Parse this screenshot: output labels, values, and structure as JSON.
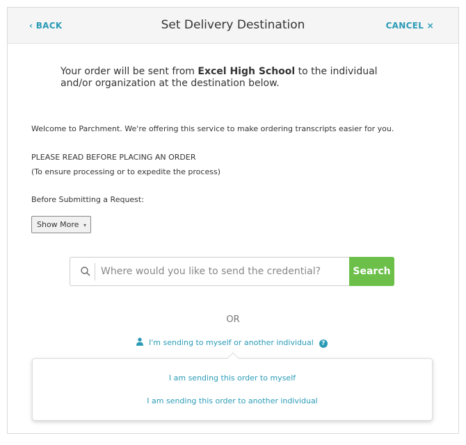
{
  "header": {
    "back_label": "‹ BACK",
    "title": "Set Delivery Destination",
    "cancel_label": "CANCEL ×"
  },
  "intro": {
    "prefix": "Your order will be sent from ",
    "school": "Excel High School",
    "suffix": " to the individual and/or organization at the destination below."
  },
  "notice": {
    "welcome": "Welcome to Parchment. We're offering this service to make ordering transcripts easier for you.",
    "read_heading": "PLEASE READ BEFORE PLACING AN ORDER",
    "read_sub": "(To ensure processing or to expedite the process)",
    "before": "Before Submitting a Request:",
    "show_more_label": "Show More",
    "show_more_caret": "▾"
  },
  "search": {
    "placeholder": "Where would you like to send the credential?",
    "value": "",
    "button_label": "Search",
    "icon": "search-icon"
  },
  "or_label": "OR",
  "individual": {
    "label": "I'm sending to myself or another individual",
    "icon": "person-icon",
    "help_icon": "question-circle-icon",
    "help_glyph": "?"
  },
  "dropdown": {
    "items": [
      "I am sending this order to myself",
      "I am sending this order to another individual"
    ]
  },
  "colors": {
    "accent": "#2a9bb6",
    "search_button": "#6cc04a",
    "header_bg": "#f5f5f5"
  }
}
